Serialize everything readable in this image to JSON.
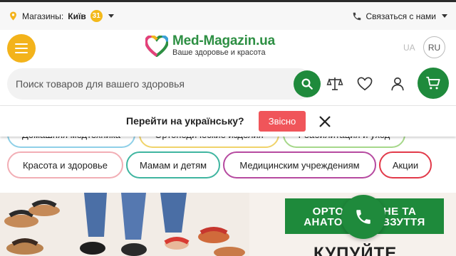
{
  "topbar": {
    "stores_label": "Магазины:",
    "city": "Київ",
    "store_count": "31",
    "contact_label": "Связаться с нами"
  },
  "header": {
    "logo_title": "Med-Magazin.ua",
    "logo_subtitle": "Ваше здоровье и красота",
    "lang_ua": "UA",
    "lang_ru": "RU"
  },
  "search": {
    "placeholder": "Поиск товаров для вашего здоровья",
    "value": ""
  },
  "lang_prompt": {
    "question": "Перейти на українську?",
    "accept_label": "Звісно"
  },
  "categories": [
    {
      "label": "Домашняя медтехника",
      "color": "#8fd0e8"
    },
    {
      "label": "Ортопедические изделия",
      "color": "#f0d36a"
    },
    {
      "label": "Реабилитация и уход",
      "color": "#a6d88a"
    },
    {
      "label": "Красота и здоровье",
      "color": "#f2aeb5"
    },
    {
      "label": "Мамам и детям",
      "color": "#3fb5a0"
    },
    {
      "label": "Медицинским учреждениям",
      "color": "#b64aa0"
    },
    {
      "label": "Акции",
      "color": "#e23a4a"
    }
  ],
  "banner": {
    "line1": "ОРТОПЕДИЧНЕ ТА",
    "line2": "АНАТОМІЧНЕ ВЗУТТЯ",
    "buy_label": "КУПУЙТЕ"
  },
  "colors": {
    "brand_green": "#1f8a3c",
    "accent_yellow": "#f3b31b",
    "accept_red": "#f0555a"
  }
}
